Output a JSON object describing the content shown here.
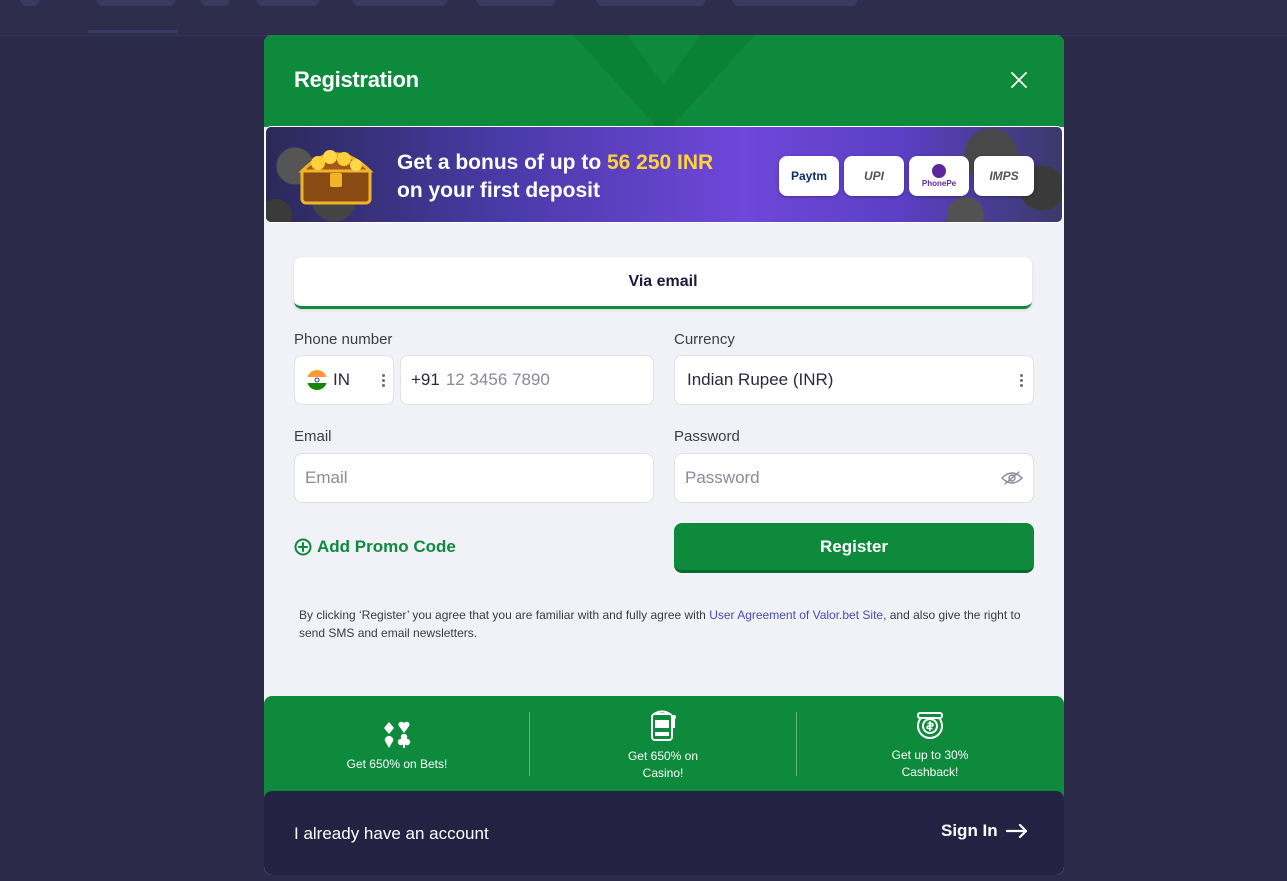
{
  "modal": {
    "title": "Registration"
  },
  "banner": {
    "line1_prefix": "Get a bonus of up to ",
    "line1_amount": "56 250 INR",
    "line2": "on your first deposit",
    "payments": [
      "Paytm",
      "UPI",
      "PhonePe",
      "IMPS"
    ]
  },
  "tabs": {
    "active": "Via email"
  },
  "form": {
    "phone": {
      "label": "Phone number",
      "country_code": "IN",
      "prefix": "+91",
      "placeholder": "12 3456 7890"
    },
    "currency": {
      "label": "Currency",
      "value": "Indian Rupee (INR)"
    },
    "email": {
      "label": "Email",
      "placeholder": "Email"
    },
    "password": {
      "label": "Password",
      "placeholder": "Password"
    },
    "promo_label": "Add Promo Code",
    "register_label": "Register",
    "terms_prefix": "By clicking ‘Register’ you agree that you are familiar with and fully agree with ",
    "terms_link": "User Agreement of Valor.bet Site",
    "terms_suffix": ", and also give the right to send SMS and email newsletters."
  },
  "benefits": [
    {
      "icon": "cards-suits-icon",
      "text": "Get 650% on Bets!"
    },
    {
      "icon": "slot-machine-icon",
      "text": "Get 650% on Casino!"
    },
    {
      "icon": "cashback-coin-icon",
      "text": "Get up to 30% Cashback!"
    }
  ],
  "footer": {
    "text": "I already have an account",
    "signin_label": "Sign In"
  },
  "colors": {
    "brand_green": "#0d8a3b",
    "backdrop": "#2b2a48",
    "footer_bg": "#232242",
    "bonus_yellow": "#ffd43b"
  }
}
